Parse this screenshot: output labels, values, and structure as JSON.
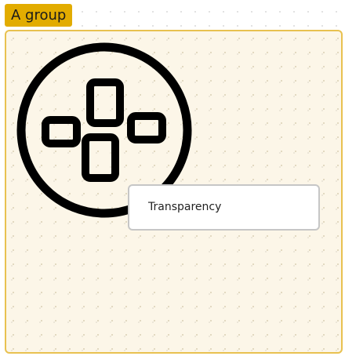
{
  "group": {
    "label": "A group",
    "tag_color": "#e2ac00",
    "border_color": "#e8c150",
    "fill_color": "#fbf4e4"
  },
  "icon": {
    "name": "gamepad-dpad-icon",
    "color": "#000000"
  },
  "node": {
    "label": "Transparency",
    "border_color": "#c6c6c6"
  }
}
